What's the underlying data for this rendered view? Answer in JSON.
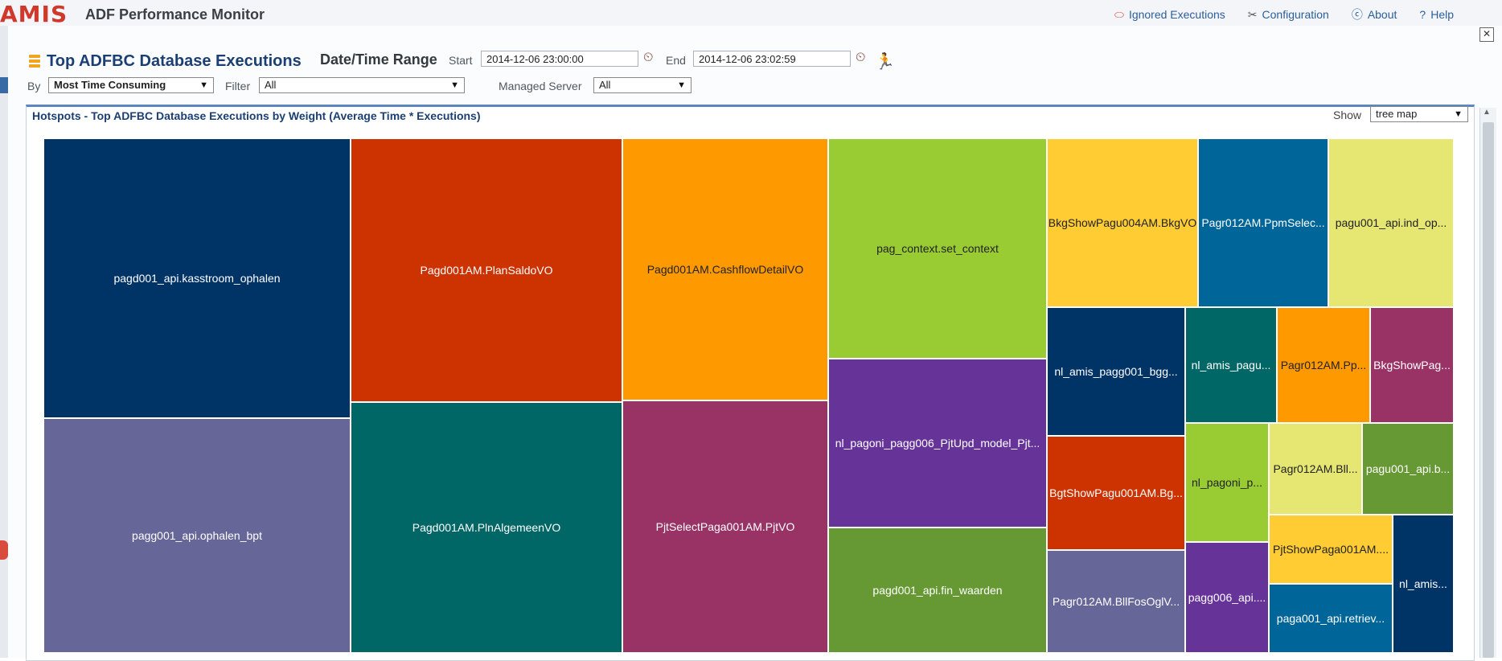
{
  "app": {
    "brand": "AMIS",
    "title": "ADF Performance Monitor",
    "links": [
      {
        "label": "Ignored Executions",
        "icon": "ignored-icon"
      },
      {
        "label": "Configuration",
        "icon": "wrench-icon"
      },
      {
        "label": "About",
        "icon": "info-icon"
      },
      {
        "label": "Help",
        "icon": "help-icon"
      }
    ],
    "close_glyph": "✕"
  },
  "toolbar": {
    "title": "Top ADFBC Database Executions",
    "range_label": "Date/Time Range",
    "start_label": "Start",
    "start_value": "2014-12-06 23:00:00",
    "end_label": "End",
    "end_value": "2014-12-06 23:02:59",
    "by_label": "By",
    "by_value": "Most Time Consuming",
    "filter_label": "Filter",
    "filter_value": "All",
    "server_label": "Managed Server",
    "server_value": "All"
  },
  "chart_header": {
    "title": "Hotspots - Top ADFBC Database Executions by Weight (Average Time * Executions)",
    "show_label": "Show",
    "show_value": "tree map"
  },
  "chart_data": {
    "type": "treemap",
    "title": "Hotspots - Top ADFBC Database Executions by Weight (Average Time * Executions)",
    "cells": [
      {
        "label": "pagd001_api.kasstroom_ophalen",
        "color": "#003366"
      },
      {
        "label": "pagg001_api.ophalen_bpt",
        "color": "#666699"
      },
      {
        "label": "Pagd001AM.PlanSaldoVO",
        "color": "#cc3300"
      },
      {
        "label": "Pagd001AM.PlnAlgemeenVO",
        "color": "#006666"
      },
      {
        "label": "Pagd001AM.CashflowDetailVO",
        "color": "#ff9900"
      },
      {
        "label": "PjtSelectPaga001AM.PjtVO",
        "color": "#993366"
      },
      {
        "label": "pag_context.set_context",
        "color": "#99cc33"
      },
      {
        "label": "nl_pagoni_pagg006_PjtUpd_model_Pjt...",
        "color": "#663399"
      },
      {
        "label": "pagd001_api.fin_waarden",
        "color": "#669933"
      },
      {
        "label": "BkgShowPagu004AM.BkgVO",
        "color": "#ffcc33"
      },
      {
        "label": "Pagr012AM.PpmSelec...",
        "color": "#006699"
      },
      {
        "label": "pagu001_api.ind_op...",
        "color": "#e6e673"
      },
      {
        "label": "nl_amis_pagg001_bgg...",
        "color": "#003366"
      },
      {
        "label": "nl_amis_pagu...",
        "color": "#006666"
      },
      {
        "label": "Pagr012AM.Pp...",
        "color": "#ff9900"
      },
      {
        "label": "BkgShowPag...",
        "color": "#993366"
      },
      {
        "label": "BgtShowPagu001AM.Bg...",
        "color": "#cc3300"
      },
      {
        "label": "nl_pagoni_p...",
        "color": "#99cc33"
      },
      {
        "label": "Pagr012AM.Bll...",
        "color": "#e6e673"
      },
      {
        "label": "pagu001_api.b...",
        "color": "#669933"
      },
      {
        "label": "PjtShowPaga001AM....",
        "color": "#ffcc33"
      },
      {
        "label": "nl_amis...",
        "color": "#003366"
      },
      {
        "label": "Pagr012AM.BllFosOglV...",
        "color": "#666699"
      },
      {
        "label": "pagg006_api....",
        "color": "#663399"
      },
      {
        "label": "paga001_api.retriev...",
        "color": "#006699"
      }
    ]
  }
}
